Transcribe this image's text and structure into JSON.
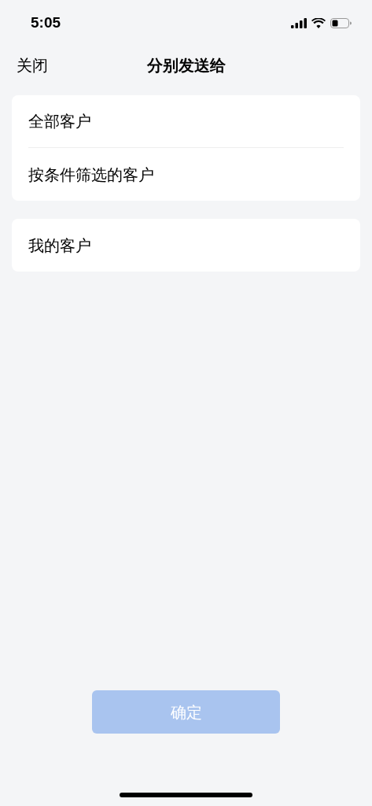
{
  "status_bar": {
    "time": "5:05"
  },
  "nav_bar": {
    "close": "关闭",
    "title": "分别发送给"
  },
  "groups": [
    {
      "items": [
        {
          "label": "全部客户"
        },
        {
          "label": "按条件筛选的客户"
        }
      ]
    },
    {
      "items": [
        {
          "label": "我的客户"
        }
      ]
    }
  ],
  "confirm_button": {
    "label": "确定",
    "disabled": true
  }
}
